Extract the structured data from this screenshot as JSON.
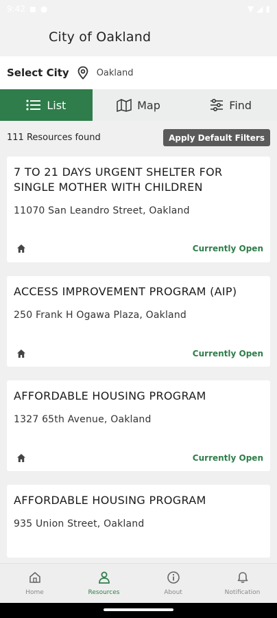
{
  "status_bar": {
    "time": "9:42"
  },
  "app_bar": {
    "title": "City of Oakland"
  },
  "city_selector": {
    "label": "Select City",
    "value": "Oakland"
  },
  "view_tabs": [
    {
      "label": "List",
      "icon": "list-icon",
      "active": true
    },
    {
      "label": "Map",
      "icon": "map-icon",
      "active": false
    },
    {
      "label": "Find",
      "icon": "filter-sliders-icon",
      "active": false
    }
  ],
  "results": {
    "count_text": "111 Resources found",
    "filter_button": "Apply Default Filters"
  },
  "resources": [
    {
      "title": "7 TO 21 DAYS URGENT SHELTER FOR SINGLE MOTHER WITH CHILDREN",
      "address": "11070 San Leandro Street, Oakland",
      "icon": "home-icon",
      "status": "Currently Open"
    },
    {
      "title": "ACCESS IMPROVEMENT PROGRAM (AIP)",
      "address": "250 Frank H Ogawa Plaza, Oakland",
      "icon": "home-icon",
      "status": "Currently Open"
    },
    {
      "title": "AFFORDABLE HOUSING PROGRAM",
      "address": "1327 65th Avenue, Oakland",
      "icon": "home-icon",
      "status": "Currently Open"
    },
    {
      "title": "AFFORDABLE HOUSING PROGRAM",
      "address": "935 Union Street, Oakland",
      "icon": "home-icon",
      "status": ""
    }
  ],
  "bottom_nav": [
    {
      "label": "Home",
      "icon": "home-outline-icon",
      "active": false
    },
    {
      "label": "Resources",
      "icon": "person-icon",
      "active": true
    },
    {
      "label": "About",
      "icon": "info-icon",
      "active": false
    },
    {
      "label": "Notification",
      "icon": "bell-icon",
      "active": false
    }
  ],
  "colors": {
    "accent": "#2e7d4a",
    "filter_button_bg": "#5a5a5a",
    "card_bg": "#ffffff",
    "page_bg": "#f0f0f0"
  }
}
